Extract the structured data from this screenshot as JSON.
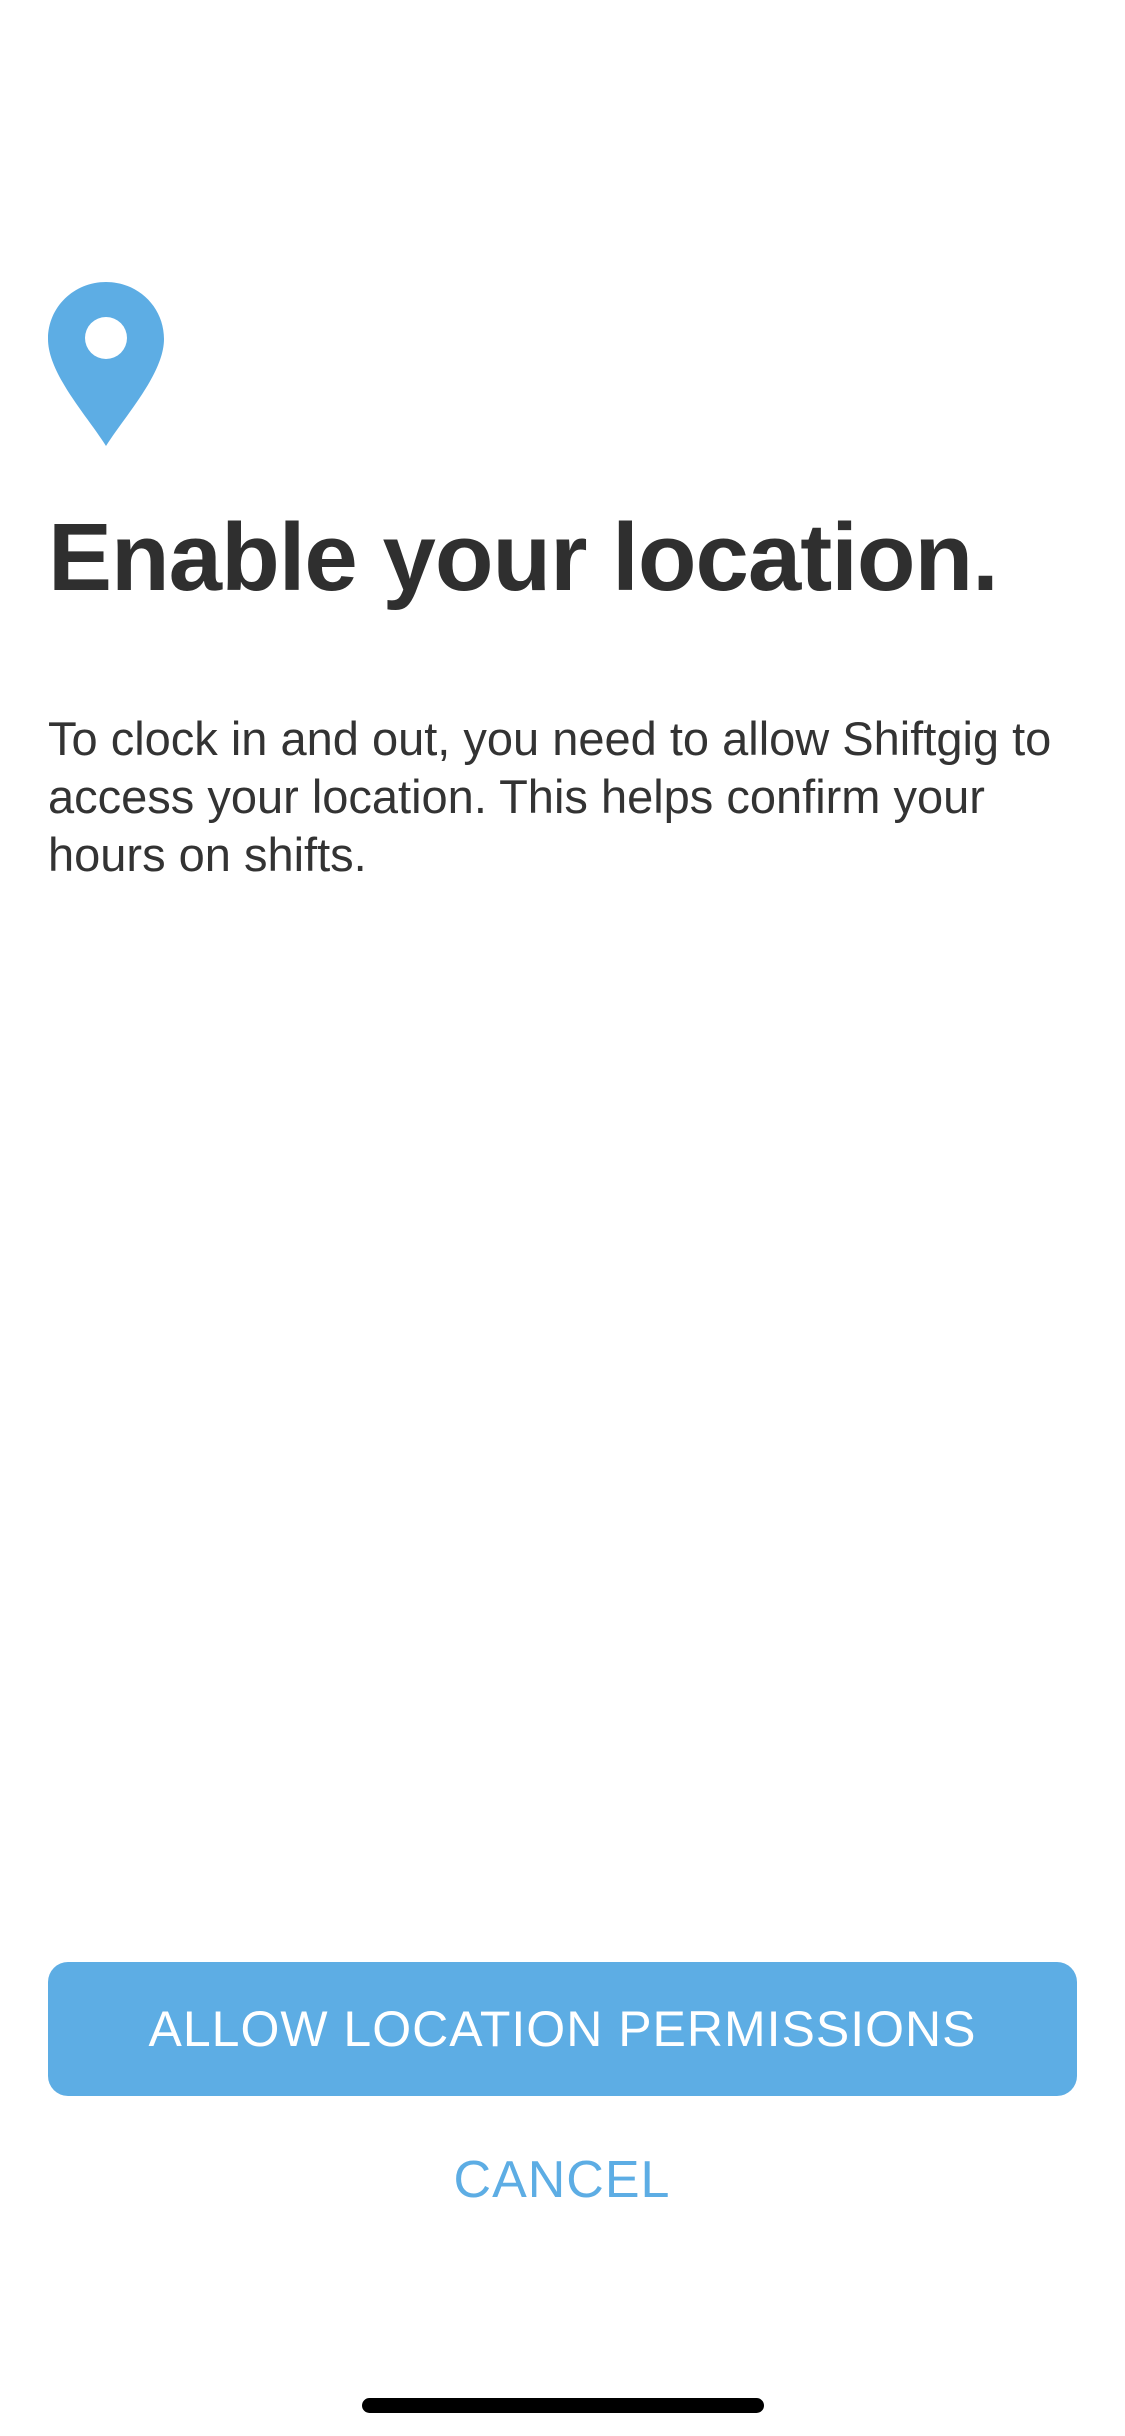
{
  "colors": {
    "accent": "#5dade4",
    "title_text": "#2f2f2f",
    "body_text": "#333333",
    "background": "#ffffff"
  },
  "hero": {
    "icon": "location-pin-icon"
  },
  "title": "Enable your location.",
  "description": "To clock in and out, you need to allow Shiftgig to access your location. This helps confirm your hours on shifts.",
  "actions": {
    "allow_label": "ALLOW LOCATION PERMISSIONS",
    "cancel_label": "CANCEL"
  }
}
